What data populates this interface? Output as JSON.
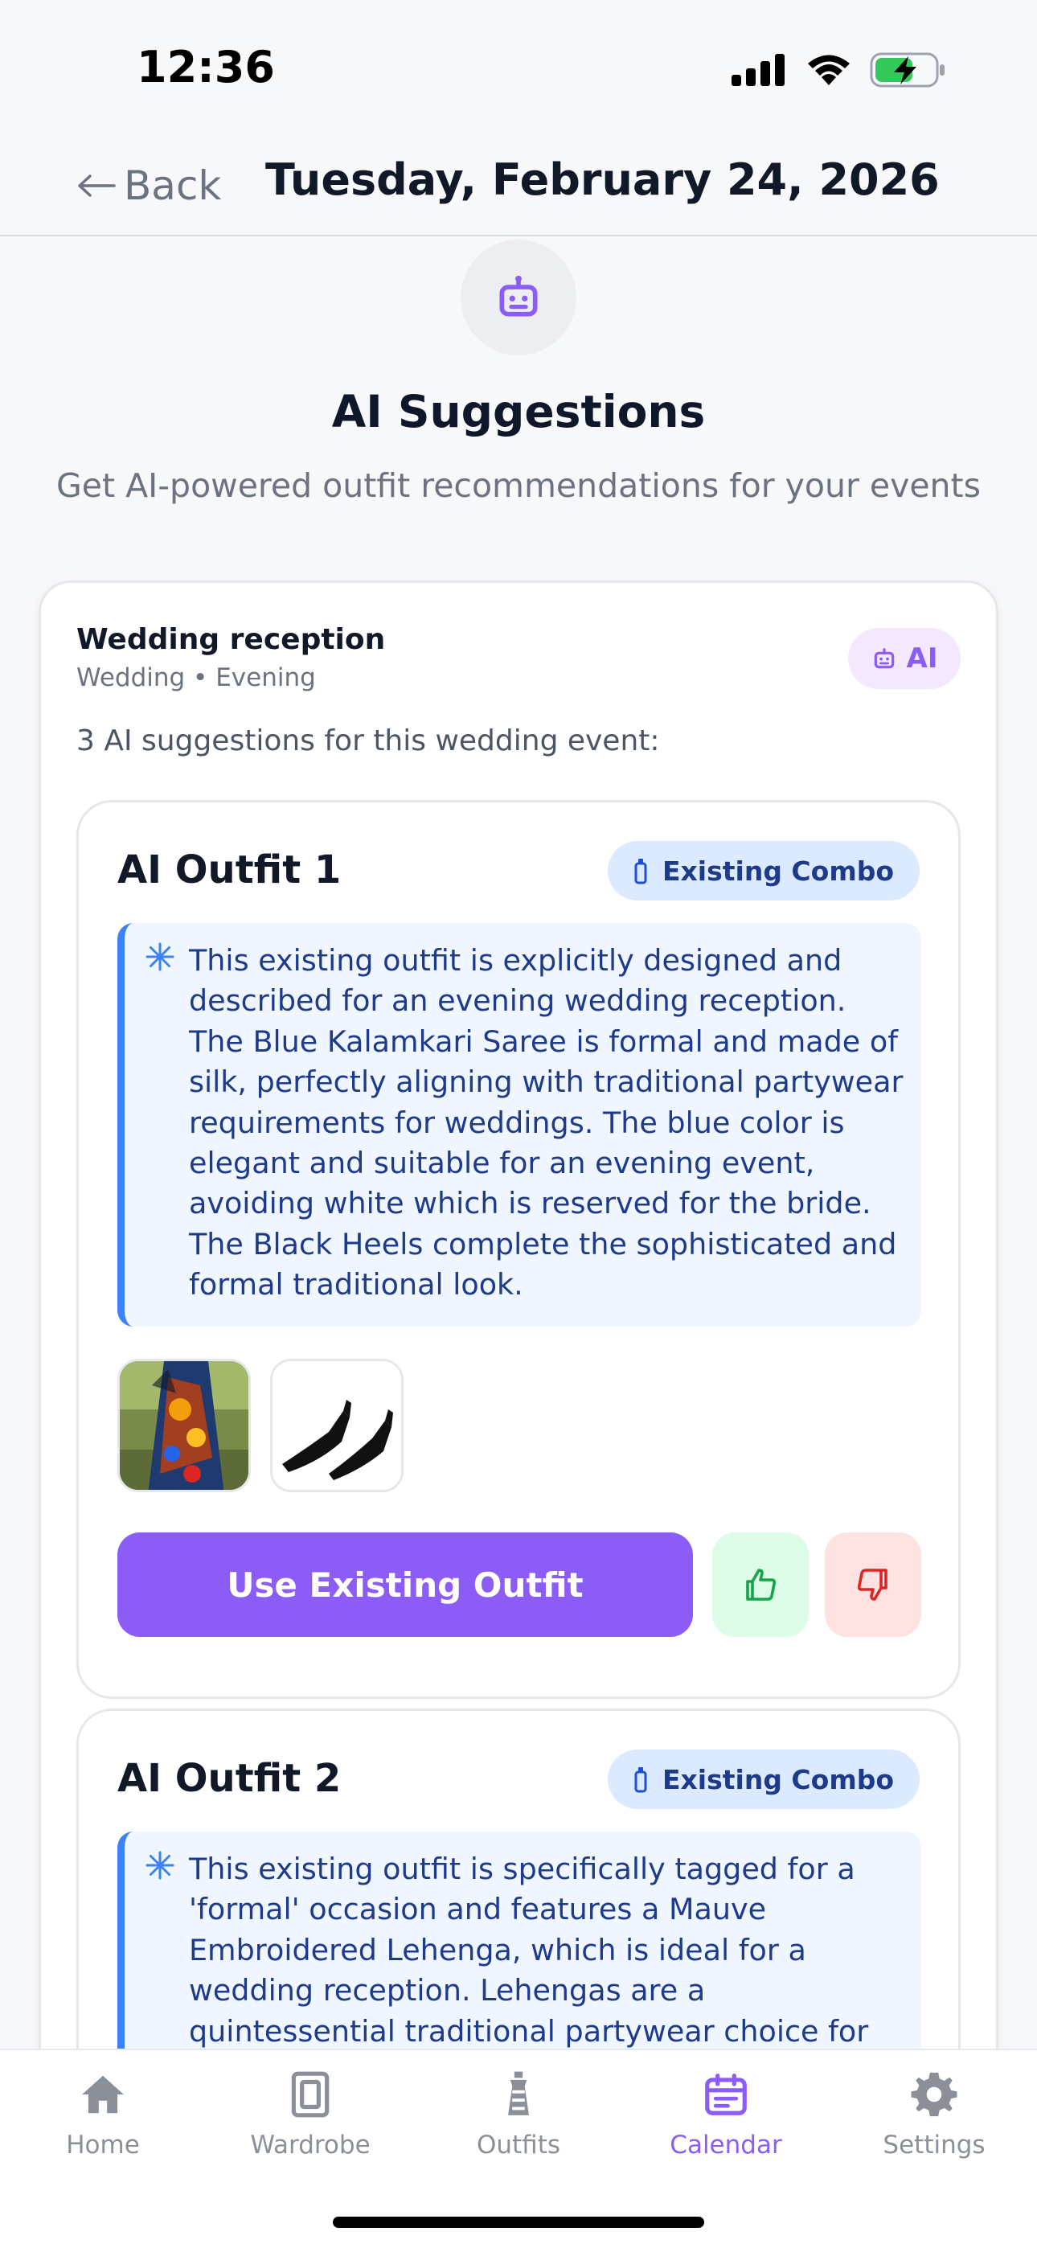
{
  "status_bar": {
    "time": "12:36"
  },
  "header": {
    "back_label": "Back",
    "title": "Tuesday, February 24, 2026"
  },
  "hero": {
    "icon": "robot-icon",
    "title": "AI Suggestions",
    "subtitle": "Get AI-powered outfit recommendations for your events"
  },
  "event": {
    "title": "Wedding reception",
    "meta": "Wedding • Evening",
    "badge": "AI",
    "count_text": "3 AI suggestions for this wedding event:"
  },
  "outfits": [
    {
      "title": "AI Outfit 1",
      "badge": "Existing Combo",
      "reason": "This existing outfit is explicitly designed and described for an evening wedding reception. The Blue Kalamkari Saree is formal and made of silk, perfectly aligning with traditional partywear requirements for weddings. The blue color is elegant and suitable for an evening event, avoiding white which is reserved for the bride. The Black Heels complete the sophisticated and formal traditional look.",
      "items": [
        "saree-image",
        "heels-image"
      ],
      "action_label": "Use Existing Outfit"
    },
    {
      "title": "AI Outfit 2",
      "badge": "Existing Combo",
      "reason": "This existing outfit is specifically tagged for a 'formal' occasion and features a Mauve Embroidered Lehenga, which is ideal for a wedding reception. Lehengas are a quintessential traditional partywear choice for"
    }
  ],
  "tabs": [
    {
      "label": "Home",
      "icon": "home-icon"
    },
    {
      "label": "Wardrobe",
      "icon": "wardrobe-icon"
    },
    {
      "label": "Outfits",
      "icon": "outfits-icon"
    },
    {
      "label": "Calendar",
      "icon": "calendar-icon",
      "active": true
    },
    {
      "label": "Settings",
      "icon": "gear-icon"
    }
  ],
  "colors": {
    "accent": "#8b5cf6",
    "badge_blue_bg": "#dbeafe",
    "reason_bg": "#eff6ff",
    "reason_border": "#3b82f6",
    "like_bg": "#dcfce7",
    "dislike_bg": "#fee2e2"
  }
}
